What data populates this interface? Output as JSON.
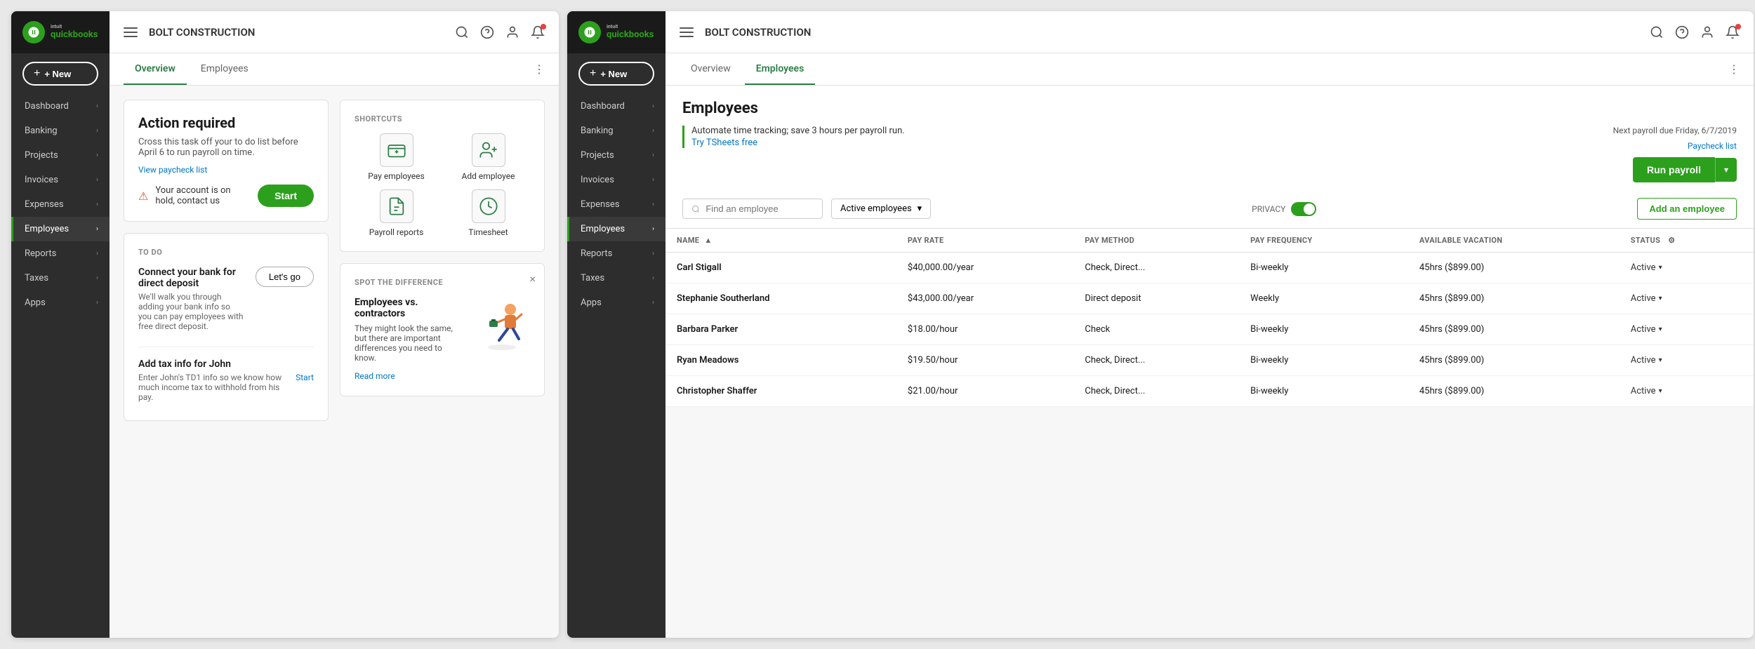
{
  "left_panel": {
    "company": "BOLT CONSTRUCTION",
    "new_btn": "+ New",
    "sidebar": {
      "items": [
        {
          "label": "Dashboard",
          "active": false
        },
        {
          "label": "Banking",
          "active": false
        },
        {
          "label": "Projects",
          "active": false
        },
        {
          "label": "Invoices",
          "active": false
        },
        {
          "label": "Expenses",
          "active": false
        },
        {
          "label": "Employees",
          "active": true
        },
        {
          "label": "Reports",
          "active": false
        },
        {
          "label": "Taxes",
          "active": false
        },
        {
          "label": "Apps",
          "active": false
        }
      ]
    },
    "tabs": {
      "items": [
        {
          "label": "Overview",
          "active": true
        },
        {
          "label": "Employees",
          "active": false
        }
      ]
    },
    "action_required": {
      "title": "Action required",
      "description": "Cross this task off your to do list before April 6 to run payroll on time.",
      "view_link": "View paycheck list",
      "hold_text": "Your account is on hold, contact us",
      "start_btn": "Start"
    },
    "todo": {
      "title": "TO DO",
      "items": [
        {
          "title": "Connect your bank for direct deposit",
          "desc": "We'll walk you through adding your bank info so you can pay employees with free direct deposit.",
          "cta": "Let's go",
          "cta_type": "button"
        },
        {
          "title": "Add tax info for John",
          "desc": "Enter John's TD1 info so we know how much income tax to withhold from his pay.",
          "cta": "Start",
          "cta_type": "link"
        }
      ]
    },
    "shortcuts": {
      "title": "SHORTCUTS",
      "items": [
        {
          "label": "Pay employees",
          "icon": "payroll-icon"
        },
        {
          "label": "Add employee",
          "icon": "add-person-icon"
        },
        {
          "label": "Payroll reports",
          "icon": "reports-icon"
        },
        {
          "label": "Timesheet",
          "icon": "timesheet-icon"
        }
      ]
    },
    "spot": {
      "title": "SPOT THE DIFFERENCE",
      "heading": "Employees vs. contractors",
      "desc": "They might look the same, but there are important differences you need to know.",
      "read_more": "Read more"
    }
  },
  "right_panel": {
    "company": "BOLT CONSTRUCTION",
    "new_btn": "+ New",
    "sidebar": {
      "items": [
        {
          "label": "Dashboard",
          "active": false
        },
        {
          "label": "Banking",
          "active": false
        },
        {
          "label": "Projects",
          "active": false
        },
        {
          "label": "Invoices",
          "active": false
        },
        {
          "label": "Expenses",
          "active": false
        },
        {
          "label": "Employees",
          "active": true
        },
        {
          "label": "Reports",
          "active": false
        },
        {
          "label": "Taxes",
          "active": false
        },
        {
          "label": "Apps",
          "active": false
        }
      ]
    },
    "tabs": {
      "items": [
        {
          "label": "Overview",
          "active": false
        },
        {
          "label": "Employees",
          "active": true
        }
      ]
    },
    "employees": {
      "title": "Employees",
      "tsheets_banner": "Automate time tracking; save 3 hours per payroll run.",
      "tsheets_link": "Try TSheets free",
      "payroll_due": "Next payroll due Friday, 6/7/2019",
      "paycheck_list": "Paycheck list",
      "run_payroll_btn": "Run payroll",
      "privacy_label": "PRIVACY",
      "search_placeholder": "Find an employee",
      "filter_label": "Active employees",
      "add_employee_btn": "Add an employee",
      "table": {
        "columns": [
          {
            "label": "NAME",
            "sortable": true
          },
          {
            "label": "PAY RATE"
          },
          {
            "label": "PAY METHOD"
          },
          {
            "label": "PAY FREQUENCY"
          },
          {
            "label": "AVAILABLE VACATION"
          },
          {
            "label": "STATUS"
          }
        ],
        "rows": [
          {
            "name": "Carl Stigall",
            "pay_rate": "$40,000.00/year",
            "pay_method": "Check, Direct...",
            "pay_frequency": "Bi-weekly",
            "vacation": "45hrs ($899.00)",
            "status": "Active"
          },
          {
            "name": "Stephanie Southerland",
            "pay_rate": "$43,000.00/year",
            "pay_method": "Direct deposit",
            "pay_frequency": "Weekly",
            "vacation": "45hrs ($899.00)",
            "status": "Active"
          },
          {
            "name": "Barbara Parker",
            "pay_rate": "$18.00/hour",
            "pay_method": "Check",
            "pay_frequency": "Bi-weekly",
            "vacation": "45hrs ($899.00)",
            "status": "Active"
          },
          {
            "name": "Ryan Meadows",
            "pay_rate": "$19.50/hour",
            "pay_method": "Check, Direct...",
            "pay_frequency": "Bi-weekly",
            "vacation": "45hrs ($899.00)",
            "status": "Active"
          },
          {
            "name": "Christopher Shaffer",
            "pay_rate": "$21.00/hour",
            "pay_method": "Check, Direct...",
            "pay_frequency": "Bi-weekly",
            "vacation": "45hrs ($899.00)",
            "status": "Active"
          }
        ]
      }
    }
  }
}
